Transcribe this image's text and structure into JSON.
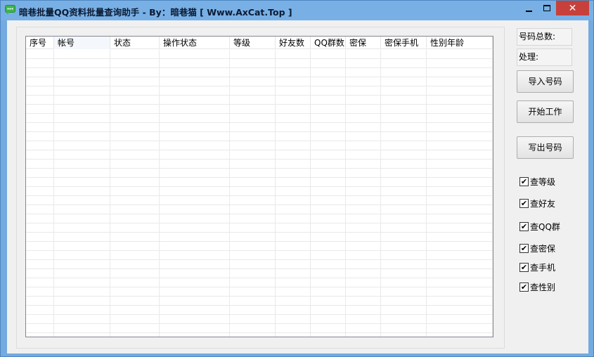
{
  "window": {
    "title": "暗巷批量QQ资料批量查询助手 - By：暗巷猫  [ Www.AxCat.Top ]",
    "close_glyph": "✕"
  },
  "table": {
    "columns": [
      "序号",
      "帐号",
      "状态",
      "操作状态",
      "等级",
      "好友数",
      "QQ群数",
      "密保",
      "密保手机",
      "性别年龄"
    ]
  },
  "panel": {
    "total_label": "号码总数:",
    "processed_label": "处理:",
    "import_button": "导入号码",
    "start_button": "开始工作",
    "export_button": "写出号码",
    "checkboxes": [
      {
        "label": "查等级",
        "checked": true
      },
      {
        "label": "查好友",
        "checked": true
      },
      {
        "label": "查QQ群",
        "checked": true
      },
      {
        "label": "查密保",
        "checked": true
      },
      {
        "label": "查手机",
        "checked": true
      },
      {
        "label": "查性别",
        "checked": true
      }
    ],
    "check_glyph": "✔"
  },
  "colors": {
    "titlebar": "#78b0e6",
    "close_button": "#c7413a",
    "client_bg": "#f0f0f0"
  }
}
